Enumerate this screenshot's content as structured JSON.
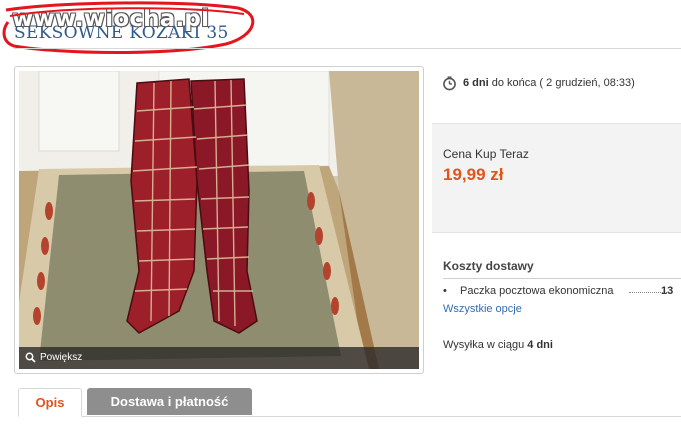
{
  "watermark": {
    "text": "www.wiocha.pl"
  },
  "listing": {
    "title": "SEKSOWNE KOZAKI 35"
  },
  "photo": {
    "enlarge_label": "Powiększ",
    "enlarge_icon": "magnifier-icon",
    "alt": "red crocodile-print knee-high boots on a patterned rug"
  },
  "countdown": {
    "icon": "clock-icon",
    "days": "6 dni",
    "suffix": " do końca ( 2 grudzień, 08:33)"
  },
  "buy_now": {
    "label": "Cena Kup Teraz",
    "price": "19,99 zł"
  },
  "shipping": {
    "title": "Koszty dostawy",
    "items": [
      {
        "bullet": "•",
        "name": "Paczka pocztowa ekonomiczna",
        "price": "13"
      }
    ],
    "all_options": "Wszystkie opcje",
    "dispatch_prefix": "Wysyłka w ciągu ",
    "dispatch_value": "4 dni"
  },
  "tabs": [
    {
      "label": "Opis",
      "active": true
    },
    {
      "label": "Dostawa i płatność",
      "active": false
    }
  ],
  "colors": {
    "accent": "#e1551b",
    "title": "#2f5a8d",
    "link": "#2f6fb3",
    "scribble": "#e4151d"
  }
}
